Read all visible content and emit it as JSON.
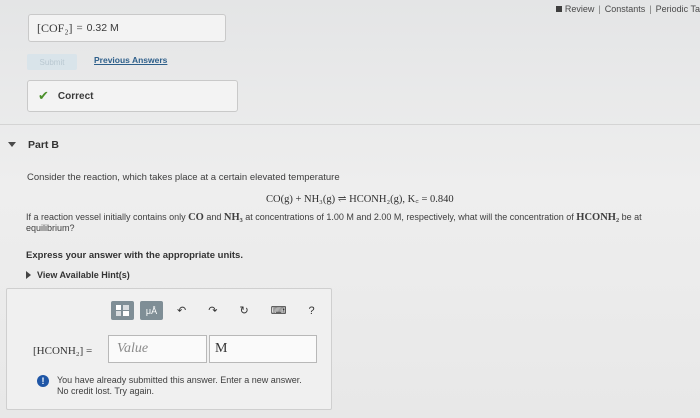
{
  "topbar": {
    "review": "Review",
    "constants": "Constants",
    "periodic": "Periodic Ta"
  },
  "part_a": {
    "answer_lhs": "[COF₂]",
    "answer_eq": "=",
    "answer_value": "0.32 M",
    "submit_label": "Submit",
    "previous_answers": "Previous Answers",
    "correct_label": "Correct"
  },
  "part_b": {
    "title": "Part B",
    "intro": "Consider the reaction, which takes place at a certain elevated temperature",
    "equation": "CO(g) + NH₃(g) ⇌ HCONH₂(g),   K꜀ = 0.840",
    "q_text1": "If a reaction vessel initially contains only ",
    "q_co": "CO",
    "q_and": " and ",
    "q_nh3": "NH₃",
    "q_text2": " at concentrations of 1.00 M and 2.00 M, respectively, what will the concentration of ",
    "q_hconh2": "HCONH₂",
    "q_text3": " be at equilibrium?",
    "express": "Express your answer with the appropriate units.",
    "hints": "View Available Hint(s)",
    "toolbar": {
      "mu_label": "μÅ",
      "undo_icon": "↶",
      "redo_icon": "↷",
      "reset_icon": "↻",
      "keyboard_icon": "⌨",
      "help_icon": "?"
    },
    "answer_label": "[HCONH₂] =",
    "value_placeholder": "Value",
    "unit_value": "M",
    "warn_line1": "You have already submitted this answer. Enter a new answer.",
    "warn_line2": "No credit lost. Try again."
  }
}
